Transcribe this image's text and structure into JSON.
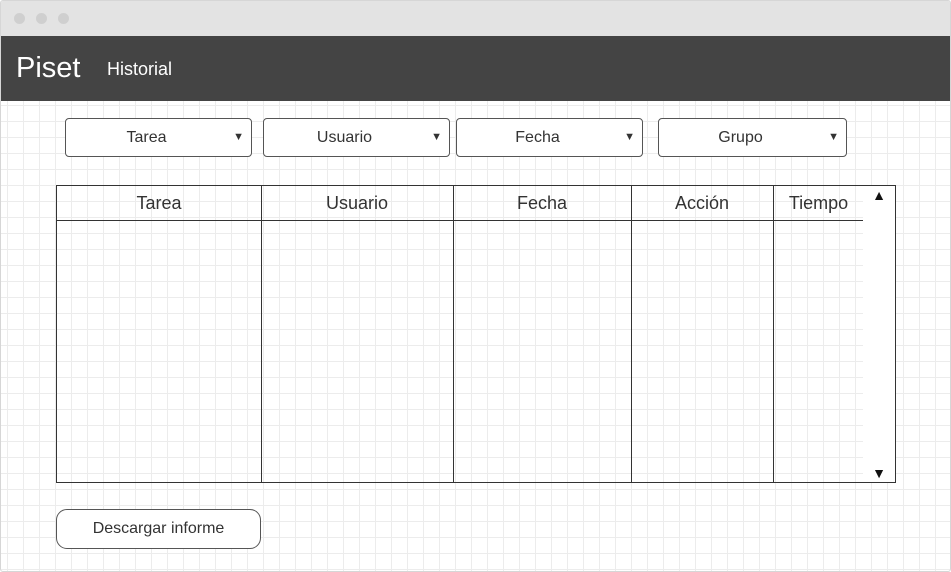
{
  "app": {
    "brand": "Piset",
    "nav": {
      "historial": "Historial"
    }
  },
  "filters": [
    {
      "label": "Tarea",
      "icon": "chevron-down-icon"
    },
    {
      "label": "Usuario",
      "icon": "chevron-down-icon"
    },
    {
      "label": "Fecha",
      "icon": "chevron-down-icon"
    },
    {
      "label": "Grupo",
      "icon": "chevron-down-icon"
    }
  ],
  "table": {
    "columns": [
      "Tarea",
      "Usuario",
      "Fecha",
      "Acción",
      "Tiempo"
    ],
    "rows": []
  },
  "actions": {
    "download_report": "Descargar informe"
  },
  "colors": {
    "appbar": "#444444",
    "titlebar": "#e3e3e3",
    "border": "#333333"
  }
}
